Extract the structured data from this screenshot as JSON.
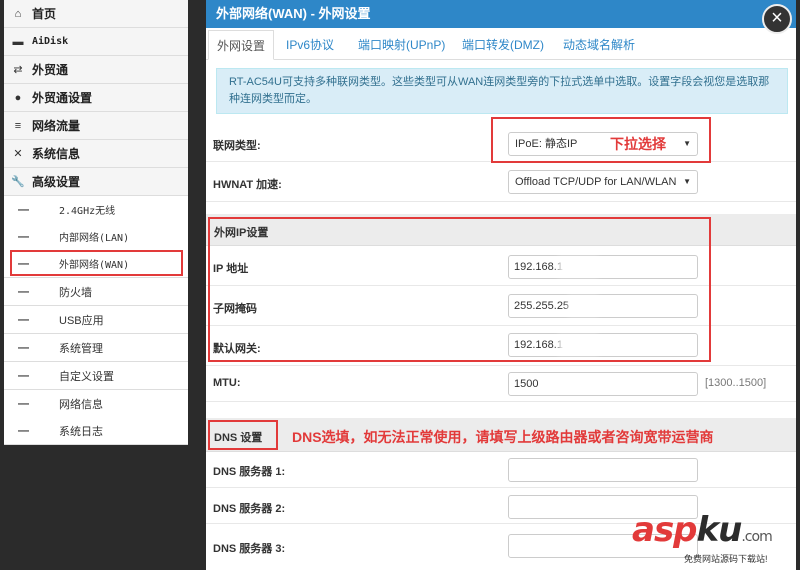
{
  "nav": {
    "main_items": [
      {
        "icon": "home-icon",
        "glyph": "⌂",
        "label": "首页"
      },
      {
        "icon": "drive-icon",
        "glyph": "▬",
        "label": "AiDisk"
      },
      {
        "icon": "exchange-icon",
        "glyph": "⇄",
        "label": "外贸通"
      },
      {
        "icon": "globe-icon",
        "glyph": "●",
        "label": "外贸通设置"
      },
      {
        "icon": "list-icon",
        "glyph": "≡",
        "label": "网络流量"
      },
      {
        "icon": "shuffle-icon",
        "glyph": "✕",
        "label": "系统信息"
      },
      {
        "icon": "wrench-icon",
        "glyph": "🔧",
        "label": "高级设置"
      }
    ],
    "sub_items": [
      {
        "label": "2.4GHz无线"
      },
      {
        "label": "内部网络(LAN)"
      },
      {
        "label": "外部网络(WAN)"
      },
      {
        "label": "防火墙"
      },
      {
        "label": "USB应用"
      },
      {
        "label": "系统管理"
      },
      {
        "label": "自定义设置"
      },
      {
        "label": "网络信息"
      },
      {
        "label": "系统日志"
      }
    ],
    "sub_bullet": "—"
  },
  "dialog": {
    "title": "外部网络(WAN) - 外网设置",
    "close": "×",
    "tabs": [
      "外网设置",
      "IPv6协议",
      "端口映射(UPnP)",
      "端口转发(DMZ)",
      "动态域名解析"
    ],
    "info": "RT-AC54U可支持多种联网类型。这些类型可从WAN连网类型旁的下拉式选单中选取。设置字段会视您是选取那种连网类型而定。"
  },
  "form": {
    "conn_type": {
      "label": "联网类型:",
      "value": "IPoE: 静态IP",
      "annotation": "下拉选择"
    },
    "hwnat": {
      "label": "HWNAT 加速:",
      "value": "Offload TCP/UDP for LAN/WLAN"
    },
    "wan_ip_section": "外网IP设置",
    "ip": {
      "label": "IP 地址",
      "value": "192.168.1"
    },
    "mask": {
      "label": "子网掩码",
      "value": "255.255.25"
    },
    "gateway": {
      "label": "默认网关:",
      "value": "192.168.1"
    },
    "mtu": {
      "label": "MTU:",
      "value": "1500",
      "hint": "[1300..1500]"
    },
    "dns_section": "DNS 设置",
    "dns_annotation": "DNS选填，如无法正常使用，请填写上级路由器或者咨询宽带运营商",
    "dns1": {
      "label": "DNS 服务器 1:",
      "value": ""
    },
    "dns2": {
      "label": "DNS 服务器 2:",
      "value": ""
    },
    "dns3": {
      "label": "DNS 服务器 3:",
      "value": ""
    }
  },
  "caret": "▼",
  "watermark": {
    "brand_a": "asp",
    "brand_b": "ku",
    "suffix": ".com",
    "tagline": "免费网站源码下载站!"
  },
  "colors": {
    "header": "#2e87c8",
    "annotation": "#e23a3a",
    "info_bg": "#d9edf7"
  }
}
